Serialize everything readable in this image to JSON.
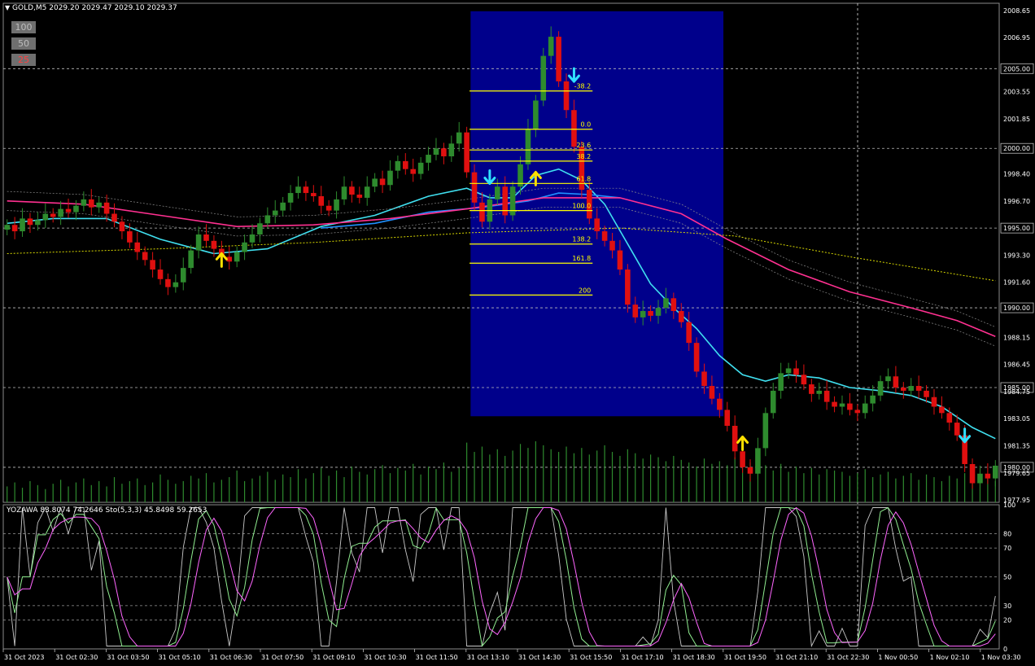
{
  "header": {
    "symbol_line": "GOLD,M5  2029.20 2029.47 2029.10 2029.37",
    "dropdown_icon": "triangle-down-icon"
  },
  "zoom_buttons": [
    "100",
    "50",
    "25"
  ],
  "indicator_label": "YOZAWA 83.8074 74.2646  Sto(5,3,3) 45.8498 59.2653",
  "fib_labels": [
    "-38.2",
    "0.0",
    "23.6",
    "38.2",
    "61.8",
    "100.0",
    "138.2",
    "161.8",
    "200"
  ],
  "time_labels": [
    "31 Oct 2023",
    "31 Oct 02:30",
    "31 Oct 03:50",
    "31 Oct 05:10",
    "31 Oct 06:30",
    "31 Oct 07:50",
    "31 Oct 09:10",
    "31 Oct 10:30",
    "31 Oct 11:50",
    "31 Oct 13:10",
    "31 Oct 14:30",
    "31 Oct 15:50",
    "31 Oct 17:10",
    "31 Oct 18:30",
    "31 Oct 19:50",
    "31 Oct 21:10",
    "31 Oct 22:30",
    "1 Nov 00:50",
    "1 Nov 02:10",
    "1 Nov 03:30"
  ],
  "colors": {
    "background": "#000000",
    "bull_candle": "#2e8b2e",
    "bear_candle": "#e01010",
    "fib_zone": "#00008b",
    "fib_line": "#ffff00",
    "ma_cyan": "#40e0f0",
    "ma_blue": "#2090ff",
    "ma_pink": "#ff3090",
    "ma_yellow_dotted": "#d8d800",
    "volume": "#2e8b2e",
    "stoch_main": "#90ee90",
    "stoch_signal": "#ff66ff",
    "oscillator": "#c8c8c8",
    "up_arrow": "#ffe000",
    "down_arrow": "#30e0ff"
  },
  "chart_data": {
    "type": "candlestick",
    "symbol": "GOLD",
    "timeframe": "M5",
    "ohlc_header": {
      "open": 2029.2,
      "high": 2029.47,
      "low": 2029.1,
      "close": 2029.37
    },
    "price_axis_ticks": [
      "2008.65",
      "2006.95",
      "2005.00",
      "2003.55",
      "2001.85",
      "2000.00",
      "1998.40",
      "1996.70",
      "1995.00",
      "1993.30",
      "1991.60",
      "1990.00",
      "1988.15",
      "1986.45",
      "1985.00",
      "1984.75",
      "1983.05",
      "1981.35",
      "1980.00",
      "1979.65",
      "1977.95"
    ],
    "highlighted_levels": [
      "2005.00",
      "2000.00",
      "1995.00",
      "1990.00",
      "1985.00",
      "1980.00"
    ],
    "ylim": [
      1977.8,
      2009.1
    ],
    "price_path": [
      1995.2,
      1994.8,
      1995.6,
      1995.2,
      1995.5,
      1995.9,
      1995.7,
      1996.2,
      1996.0,
      1996.4,
      1996.8,
      1996.3,
      1996.6,
      1995.9,
      1995.4,
      1994.8,
      1994.1,
      1993.5,
      1993.0,
      1992.4,
      1991.8,
      1991.3,
      1991.6,
      1992.5,
      1993.6,
      1994.6,
      1994.2,
      1993.7,
      1993.2,
      1992.9,
      1993.5,
      1994.1,
      1994.6,
      1995.3,
      1995.8,
      1996.1,
      1996.6,
      1997.2,
      1997.6,
      1997.2,
      1997.0,
      1996.4,
      1996.1,
      1996.8,
      1997.6,
      1997.1,
      1996.9,
      1997.6,
      1998.1,
      1997.7,
      1998.6,
      1999.2,
      1998.7,
      1998.4,
      1999.1,
      1999.6,
      2000.0,
      1999.5,
      2000.3,
      2001.0,
      1998.5,
      1996.6,
      1995.4,
      1996.8,
      1997.6,
      1995.8,
      1997.6,
      1999.0,
      2001.2,
      2003.0,
      2005.8,
      2007.0,
      2004.2,
      2002.4,
      2000.1,
      1997.4,
      1995.6,
      1994.8,
      1994.2,
      1993.6,
      1992.4,
      1990.2,
      1989.4,
      1989.8,
      1989.5,
      1990.0,
      1990.6,
      1989.8,
      1989.1,
      1987.8,
      1986.0,
      1985.1,
      1984.3,
      1983.6,
      1982.6,
      1981.0,
      1980.0,
      1979.6,
      1981.2,
      1983.4,
      1984.8,
      1985.9,
      1986.2,
      1985.8,
      1985.2,
      1984.6,
      1984.8,
      1984.1,
      1983.8,
      1984.0,
      1983.6,
      1983.4,
      1984.0,
      1984.5,
      1985.4,
      1985.7,
      1985.0,
      1984.8,
      1985.1,
      1984.8,
      1984.4,
      1983.8,
      1983.4,
      1982.8,
      1982.0,
      1980.2,
      1979.0,
      1979.6,
      1979.3,
      1980.1
    ],
    "moving_averages": [
      {
        "name": "cyan",
        "points": [
          [
            0,
            1995.3
          ],
          [
            6,
            1995.6
          ],
          [
            13,
            1995.6
          ],
          [
            20,
            1994.3
          ],
          [
            27,
            1993.4
          ],
          [
            34,
            1993.7
          ],
          [
            41,
            1995.1
          ],
          [
            48,
            1995.8
          ],
          [
            55,
            1997.0
          ],
          [
            60,
            1997.5
          ],
          [
            63,
            1996.9
          ],
          [
            66,
            1996.9
          ],
          [
            69,
            1998.3
          ],
          [
            72,
            1998.7
          ],
          [
            75,
            1998.0
          ],
          [
            78,
            1996.5
          ],
          [
            81,
            1994.0
          ],
          [
            84,
            1991.5
          ],
          [
            87,
            1990.0
          ],
          [
            90,
            1988.7
          ],
          [
            93,
            1987.0
          ],
          [
            96,
            1985.8
          ],
          [
            99,
            1985.4
          ],
          [
            102,
            1985.8
          ],
          [
            106,
            1985.6
          ],
          [
            110,
            1985.0
          ],
          [
            114,
            1984.8
          ],
          [
            118,
            1984.5
          ],
          [
            122,
            1983.8
          ],
          [
            126,
            1982.5
          ],
          [
            129,
            1981.8
          ]
        ]
      },
      {
        "name": "blue",
        "points": [
          [
            41,
            1995.0
          ],
          [
            48,
            1995.3
          ],
          [
            55,
            1996.0
          ],
          [
            62,
            1996.3
          ],
          [
            68,
            1996.7
          ],
          [
            72,
            1997.2
          ],
          [
            76,
            1997.1
          ],
          [
            80,
            1996.9
          ]
        ]
      },
      {
        "name": "pink",
        "points": [
          [
            0,
            1996.7
          ],
          [
            10,
            1996.5
          ],
          [
            20,
            1995.8
          ],
          [
            30,
            1995.1
          ],
          [
            40,
            1995.2
          ],
          [
            50,
            1995.6
          ],
          [
            60,
            1996.2
          ],
          [
            70,
            1996.9
          ],
          [
            80,
            1996.9
          ],
          [
            88,
            1995.9
          ],
          [
            94,
            1994.3
          ],
          [
            102,
            1992.4
          ],
          [
            110,
            1991.0
          ],
          [
            118,
            1990.0
          ],
          [
            124,
            1989.2
          ],
          [
            129,
            1988.2
          ]
        ]
      },
      {
        "name": "yellow_dotted",
        "points": [
          [
            0,
            1993.4
          ],
          [
            20,
            1993.7
          ],
          [
            40,
            1994.1
          ],
          [
            60,
            1994.7
          ],
          [
            80,
            1995.0
          ],
          [
            95,
            1994.5
          ],
          [
            110,
            1993.2
          ],
          [
            129,
            1991.7
          ]
        ]
      }
    ],
    "fibonacci": {
      "levels": [
        {
          "label": "-38.2",
          "price": 2003.6
        },
        {
          "label": "0.0",
          "price": 2001.2
        },
        {
          "label": "23.6",
          "price": 1999.9
        },
        {
          "label": "38.2",
          "price": 1999.2
        },
        {
          "label": "61.8",
          "price": 1997.8
        },
        {
          "label": "100.0",
          "price": 1996.1
        },
        {
          "label": "138.2",
          "price": 1994.0
        },
        {
          "label": "161.8",
          "price": 1992.8
        },
        {
          "label": "200",
          "price": 1990.8
        }
      ],
      "zone": {
        "from_bar": 61,
        "to_bar": 93,
        "price_top": 2008.6,
        "price_bottom": 1983.2
      }
    },
    "arrows": [
      {
        "type": "up",
        "bar": 28,
        "price": 1993.0
      },
      {
        "type": "down",
        "bar": 63,
        "price": 1998.2
      },
      {
        "type": "up",
        "bar": 69,
        "price": 1998.1
      },
      {
        "type": "down",
        "bar": 74,
        "price": 2004.6
      },
      {
        "type": "up",
        "bar": 96,
        "price": 1981.5
      },
      {
        "type": "down",
        "bar": 125,
        "price": 1982.0
      }
    ],
    "volume": [
      12,
      15,
      11,
      16,
      13,
      10,
      14,
      17,
      12,
      15,
      18,
      13,
      16,
      12,
      19,
      14,
      16,
      18,
      13,
      15,
      21,
      17,
      14,
      16,
      20,
      18,
      22,
      15,
      17,
      19,
      24,
      16,
      18,
      20,
      23,
      17,
      21,
      19,
      25,
      18,
      22,
      26,
      20,
      24,
      19,
      27,
      23,
      21,
      25,
      28,
      22,
      26,
      24,
      29,
      21,
      27,
      25,
      30,
      23,
      26,
      45,
      38,
      42,
      36,
      40,
      35,
      39,
      44,
      41,
      46,
      43,
      40,
      38,
      42,
      37,
      41,
      36,
      39,
      43,
      38,
      35,
      40,
      37,
      33,
      36,
      34,
      31,
      35,
      32,
      30,
      27,
      33,
      29,
      31,
      28,
      34,
      26,
      30,
      25,
      28,
      24,
      29,
      23,
      27,
      22,
      26,
      21,
      25,
      24,
      23,
      20,
      22,
      25,
      19,
      21,
      23,
      18,
      20,
      22,
      17,
      21,
      19,
      16,
      20,
      18,
      22,
      17,
      15,
      19,
      16
    ],
    "subwindow": {
      "name": "YOZAWA / Sto(5,3,3)",
      "values": {
        "yozawa_1": 83.8074,
        "yozawa_2": 74.2646,
        "sto_main": 45.8498,
        "sto_signal": 59.2653
      },
      "axis_ticks": [
        "100",
        "80",
        "70",
        "50",
        "30",
        "20",
        "0"
      ],
      "ylim": [
        0,
        100
      ]
    }
  }
}
